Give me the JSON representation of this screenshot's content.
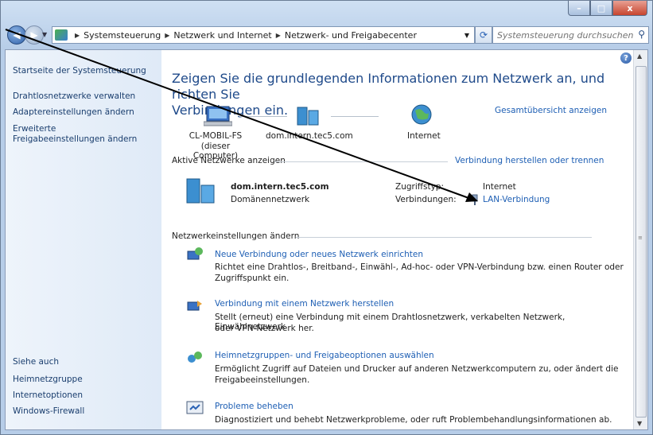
{
  "window": {
    "minimize": "–",
    "maximize": "□",
    "close": "x"
  },
  "nav": {
    "back": "◀",
    "forward": "▶",
    "breadcrumb": [
      "Systemsteuerung",
      "Netzwerk und Internet",
      "Netzwerk- und Freigabecenter"
    ],
    "refresh": "⟳",
    "search_placeholder": "Systemsteuerung durchsuchen"
  },
  "sidebar": {
    "home": "Startseite der Systemsteuerung",
    "items": [
      "Drahtlosnetzwerke verwalten",
      "Adaptereinstellungen ändern",
      "Erweiterte",
      "Freigabeeinstellungen ändern"
    ],
    "see_also": "Siehe auch",
    "see_also_items": [
      "Heimnetzgruppe",
      "Internetoptionen",
      "Windows-Firewall"
    ]
  },
  "main": {
    "heading_line1": "Zeigen Sie die grundlegenden Informationen zum Netzwerk an, und richten Sie",
    "heading_line2": "Verbindungen ein.",
    "map_link": "Gesamtübersicht anzeigen",
    "map": {
      "computer": "CL-MOBIL-FS",
      "computer_sub": "(dieser Computer)",
      "domain": "dom.intern.tec5.com",
      "internet": "Internet"
    },
    "active_networks": "Aktive Netzwerke anzeigen",
    "connect_link": "Verbindung herstellen oder trennen",
    "network_name": "dom.intern.tec5.com",
    "network_type": "Domänennetzwerk",
    "access_label": "Zugriffstyp:",
    "access_value": "Internet",
    "connections_label": "Verbindungen:",
    "connections_value": "LAN-Verbindung",
    "settings_header": "Netzwerkeinstellungen ändern",
    "tasks": [
      {
        "title": "Neue Verbindung oder neues Netzwerk einrichten",
        "line1": "Richtet eine Drahtlos-, Breitband-, Einwähl-, Ad-hoc- oder VPN-Verbindung bzw. einen Router oder",
        "line2": "Zugriffspunkt ein."
      },
      {
        "title": "Verbindung mit einem Netzwerk herstellen",
        "line1": "Stellt (erneut) eine Verbindung mit einem Drahtlosnetzwerk, verkabelten Netzwerk, Einwählnetzwerk",
        "line2": "oder VPN-Netzwerk her."
      },
      {
        "title": "Heimnetzgruppen- und Freigabeoptionen auswählen",
        "line1": "Ermöglicht Zugriff auf Dateien und Drucker auf anderen Netzwerkcomputern zu, oder ändert die",
        "line2": "Freigabeeinstellungen."
      },
      {
        "title": "Probleme beheben",
        "line1": "Diagnostiziert und behebt Netzwerkprobleme, oder ruft Problembehandlungsinformationen ab.",
        "line2": ""
      }
    ]
  },
  "colors": {
    "link": "#1e5fb4",
    "heading": "#1f4a8a",
    "annotation_arrow": "#000000"
  }
}
